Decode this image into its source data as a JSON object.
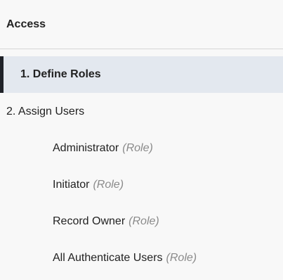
{
  "header": {
    "title": "Access"
  },
  "nav": {
    "steps": [
      {
        "label": "1. Define Roles",
        "active": true
      },
      {
        "label": "2. Assign Users",
        "active": false
      }
    ],
    "roles": [
      {
        "name": "Administrator",
        "tag": "(Role)"
      },
      {
        "name": "Initiator",
        "tag": "(Role)"
      },
      {
        "name": "Record Owner",
        "tag": "(Role)"
      },
      {
        "name": "All Authenticate Users",
        "tag": "(Role)"
      }
    ]
  },
  "colors": {
    "active_bar": "#1f2228",
    "active_background": "#e3e8ef",
    "role_tag": "#8a8a8a"
  }
}
